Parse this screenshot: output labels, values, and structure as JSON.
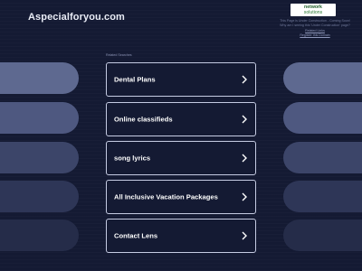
{
  "header": {
    "site_title": "Aspecialforyou.com",
    "logo": {
      "line1": "network",
      "line2": "solutions"
    },
    "ns_line1": "This Page is Under Construction - Coming Soon!",
    "ns_line2": "Why am I seeing this 'Under Construction' page?",
    "ns_link1": "Related Links",
    "ns_link2": "Register this Domain"
  },
  "related_label": "Related Searches",
  "links": [
    {
      "label": "Dental Plans"
    },
    {
      "label": "Online classifieds"
    },
    {
      "label": "song lyrics"
    },
    {
      "label": "All Inclusive Vacation Packages"
    },
    {
      "label": "Contact Lens"
    }
  ],
  "colors": {
    "background": "#141a33",
    "link_border": "#c5cbe2",
    "logo_green": "#1f5e2a"
  },
  "icons": {
    "link_chevron": "chevron-right-icon"
  }
}
